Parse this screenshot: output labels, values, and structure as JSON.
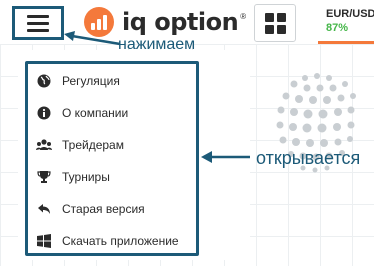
{
  "header": {
    "logo_text": "iq option",
    "logo_reg": "®",
    "asset": {
      "name": "EUR/USD",
      "change": "87%"
    }
  },
  "annotations": {
    "press": "нажимаем",
    "opens": "открывается"
  },
  "menu": {
    "items": [
      {
        "label": "Регуляция",
        "icon": "globe-icon"
      },
      {
        "label": "О компании",
        "icon": "info-icon"
      },
      {
        "label": "Трейдерам",
        "icon": "traders-icon"
      },
      {
        "label": "Турниры",
        "icon": "trophy-icon"
      },
      {
        "label": "Старая версия",
        "icon": "reply-icon"
      },
      {
        "label": "Скачать приложение",
        "icon": "windows-icon"
      }
    ]
  },
  "colors": {
    "annotation": "#1c5a78",
    "brand": "#f4793b",
    "positive": "#45b649"
  }
}
